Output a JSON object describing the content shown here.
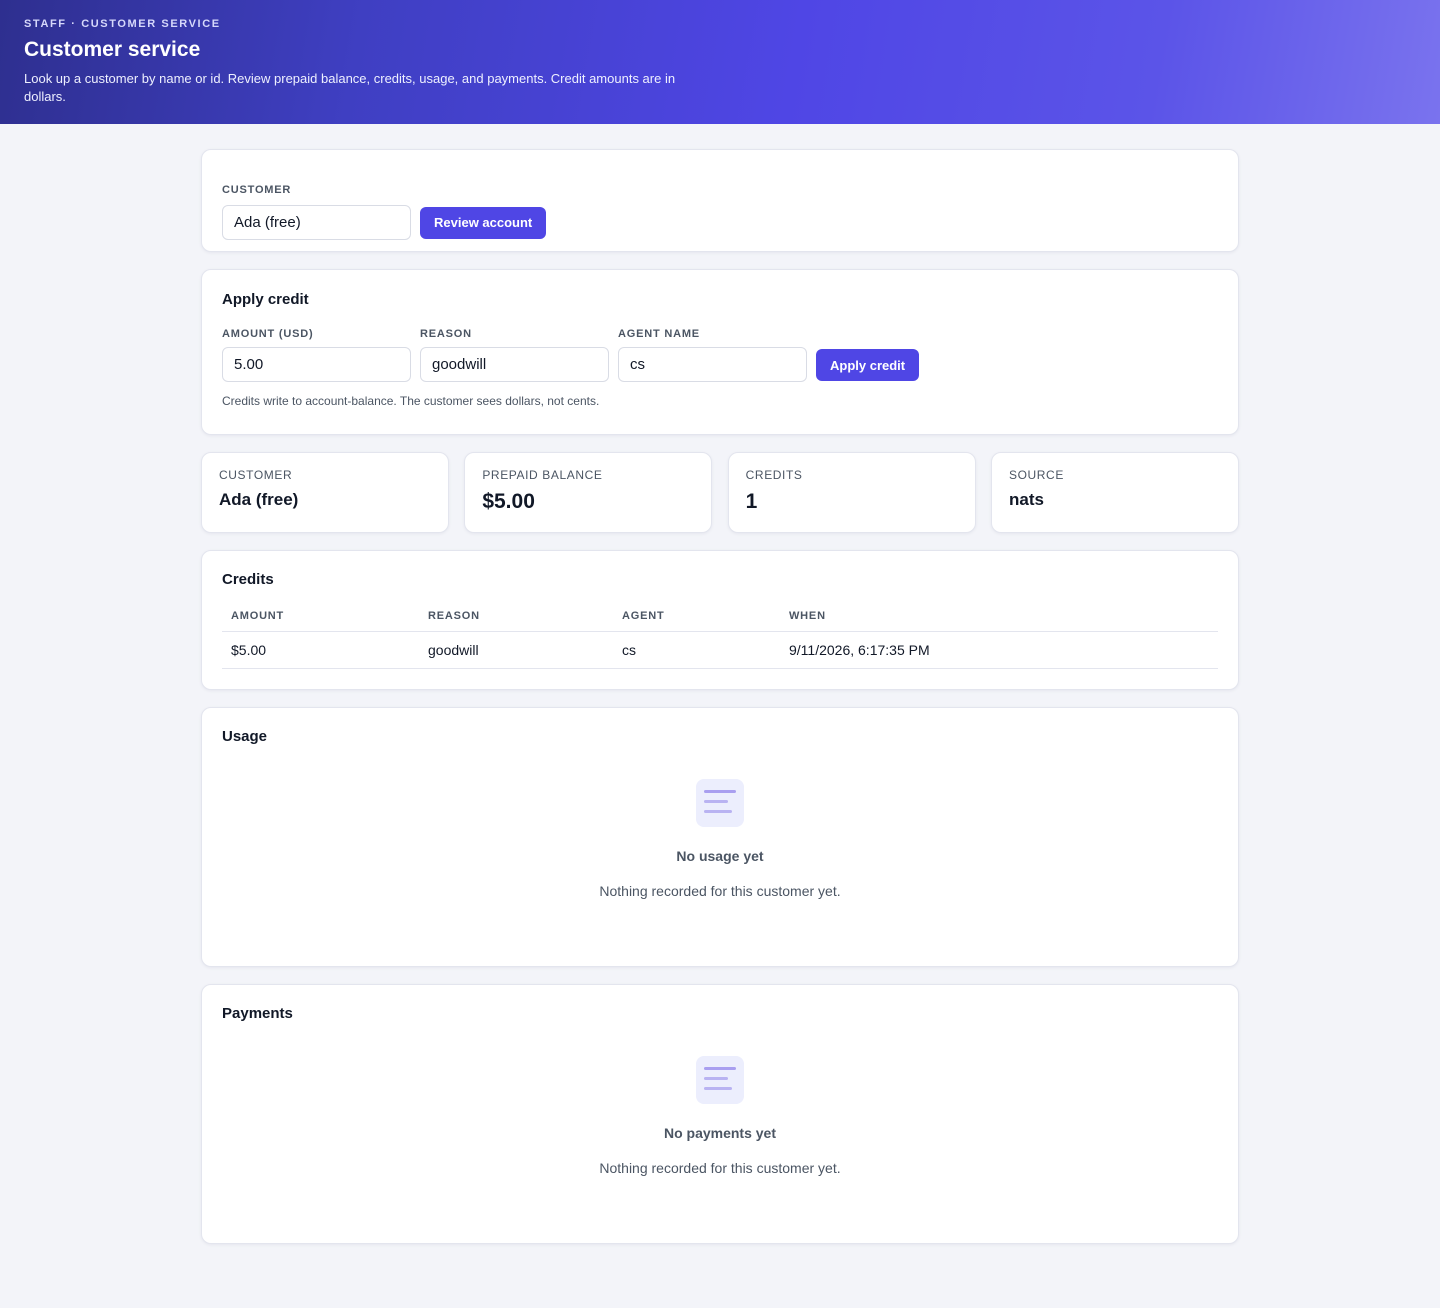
{
  "header": {
    "eyebrow": "STAFF · CUSTOMER SERVICE",
    "title": "Customer service",
    "description": "Look up a customer by name or id. Review prepaid balance, credits, usage, and payments. Credit amounts are in dollars."
  },
  "lookup": {
    "label": "CUSTOMER",
    "value": "Ada (free)",
    "button": "Review account"
  },
  "apply_credit": {
    "title": "Apply credit",
    "amount_label": "AMOUNT (USD)",
    "amount_value": "5.00",
    "reason_label": "REASON",
    "reason_value": "goodwill",
    "agent_label": "AGENT NAME",
    "agent_value": "cs",
    "button": "Apply credit",
    "hint": "Credits write to account-balance. The customer sees dollars, not cents."
  },
  "stats": [
    {
      "label": "CUSTOMER",
      "value": "Ada (free)"
    },
    {
      "label": "PREPAID BALANCE",
      "value": "$5.00"
    },
    {
      "label": "CREDITS",
      "value": "1"
    },
    {
      "label": "SOURCE",
      "value": "nats"
    }
  ],
  "credits": {
    "title": "Credits",
    "columns": [
      "AMOUNT",
      "REASON",
      "AGENT",
      "WHEN"
    ],
    "rows": [
      [
        "$5.00",
        "goodwill",
        "cs",
        "9/11/2026, 6:17:35 PM"
      ]
    ]
  },
  "usage": {
    "title": "Usage",
    "empty_title": "No usage yet",
    "empty_text": "Nothing recorded for this customer yet."
  },
  "payments": {
    "title": "Payments",
    "empty_title": "No payments yet",
    "empty_text": "Nothing recorded for this customer yet."
  },
  "colors": {
    "accent": "#4f46e5",
    "page_background": "#f3f4f9",
    "header_gradient_start": "#2e2f8f",
    "header_gradient_end": "#7a73ee"
  },
  "icons": {
    "empty_state": "document-lines-icon"
  }
}
